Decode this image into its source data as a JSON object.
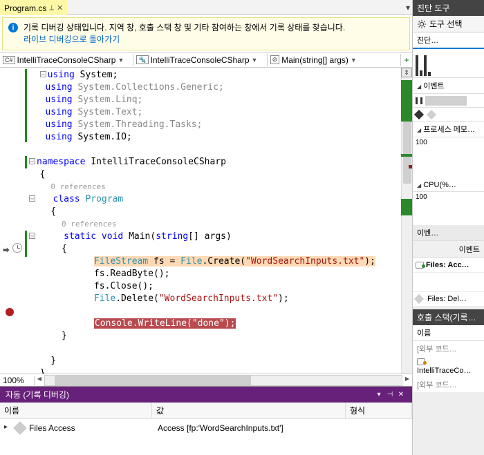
{
  "tab": {
    "name": "Program.cs",
    "pin": "⟂",
    "close": "✕"
  },
  "info_bar": {
    "text": "기록 디버깅 상태입니다. 지역 창, 호출 스택 창 및 기타 참여하는 창에서 기록 상태를 찾습니다.",
    "link": "라이브 디버깅으로 돌아가기"
  },
  "breadcrumbs": {
    "c1": {
      "badge": "C#",
      "text": "IntelliTraceConsoleCSharp"
    },
    "c2": {
      "badge": "🔩",
      "text": "IntelliTraceConsoleCSharp"
    },
    "c3": {
      "badge": "⊘",
      "text": "Main(string[] args)"
    }
  },
  "code": {
    "l1a": "using",
    "l1b": " System;",
    "l2a": "using",
    "l2b": " System.Collections.Generic;",
    "l3a": "using",
    "l3b": " System.Linq;",
    "l4a": "using",
    "l4b": " System.Text;",
    "l5a": "using",
    "l5b": " System.Threading.Tasks;",
    "l6a": "using",
    "l6b": " System.IO;",
    "l8a": "namespace",
    "l8b": " IntelliTraceConsoleCSharp",
    "ref0": "0 references",
    "l11a": "class",
    "l11b": " Program",
    "l14a": "static",
    "l14b": " void",
    "l14c": " Main(",
    "l14d": "string",
    "l14e": "[] args)",
    "l16a": "FileStream",
    "l16b": " fs = ",
    "l16c": "File",
    "l16d": ".Create(",
    "l16e": "\"WordSearchInputs.txt\"",
    "l16f": ");",
    "l17": "            fs.ReadByte();",
    "l18": "            fs.Close();",
    "l19a": "File",
    "l19b": ".Delete(",
    "l19c": "\"WordSearchInputs.txt\"",
    "l19d": ");",
    "l21a": "Console",
    "l21b": ".WriteLine(",
    "l21c": "\"done\"",
    "l21d": ");"
  },
  "zoom": "100%",
  "autos": {
    "title": "자동 (기록 디버깅)",
    "headers": {
      "name": "이름",
      "value": "값",
      "type": "형식"
    },
    "row": {
      "name": "Files Access",
      "value": "Access [fp:'WordSearchInputs.txt']"
    }
  },
  "diag": {
    "title": "진단 도구",
    "tool_select": "도구 선택",
    "tab": "진단…",
    "events_hdr": "이벤트",
    "procmem_hdr": "프로세스 메모…",
    "cpu_hdr": "CPU(%…",
    "hundred": "100",
    "events_tab": "이벤…",
    "events_col": "이벤트",
    "e1": "Files: Acc…",
    "e2": "Files: Del…"
  },
  "callstack": {
    "title": "호출 스택(기록…",
    "h_name": "이름",
    "r1": "[외부 코드…",
    "r2": "IntelliTraceCo…",
    "r3": "[외부 코드…"
  }
}
